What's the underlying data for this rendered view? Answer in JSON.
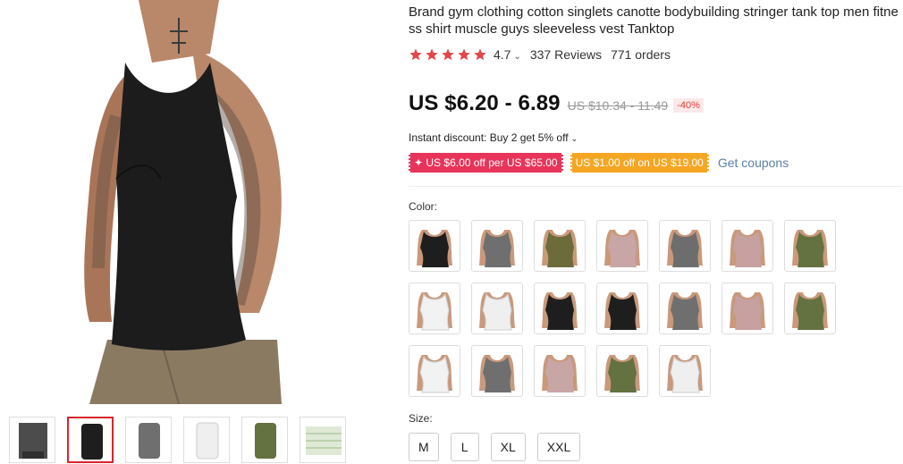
{
  "product": {
    "title": "Brand gym clothing cotton singlets canotte bodybuilding stringer tank top men fitness shirt muscle guys sleeveless vest Tanktop",
    "rating": "4.7",
    "reviews": "337 Reviews",
    "orders": "771 orders",
    "price_now": "US $6.20 - 6.89",
    "price_old": "US $10.34 - 11.49",
    "discount": "-40%",
    "instant_discount": "Instant discount: Buy 2 get 5% off",
    "coupon1": "✦ US $6.00 off per US $65.00",
    "coupon2": "US $1.00 off on US $19.00",
    "get_coupons": "Get coupons",
    "color_label": "Color:",
    "size_label": "Size:",
    "sizes": [
      "M",
      "L",
      "XL",
      "XXL"
    ]
  },
  "colors": {
    "accent_red": "#d9262c",
    "star": "#e2474b",
    "coupon_red": "#e8345a",
    "coupon_orange": "#f5a623",
    "link": "#5b7fa6"
  },
  "swatch_colors": [
    "#1e1e1e",
    "#6f6f6f",
    "#6c6b3c",
    "#c9a6a6",
    "#6d6d6d",
    "#c7a0a0",
    "#647140",
    "#f2f2f2",
    "#efefef",
    "#1e1e1e",
    "#1e1e1e",
    "#6f6f6f",
    "#c7a0a0",
    "#647140",
    "#f2f2f2",
    "#6f6f6f",
    "#c9a6a6",
    "#647140",
    "#efefef"
  ],
  "thumb_colors": [
    "#4c4c4c",
    "#1e1e1e",
    "#6f6f6f",
    "#efefef",
    "#647140",
    "#dfe9d6"
  ]
}
